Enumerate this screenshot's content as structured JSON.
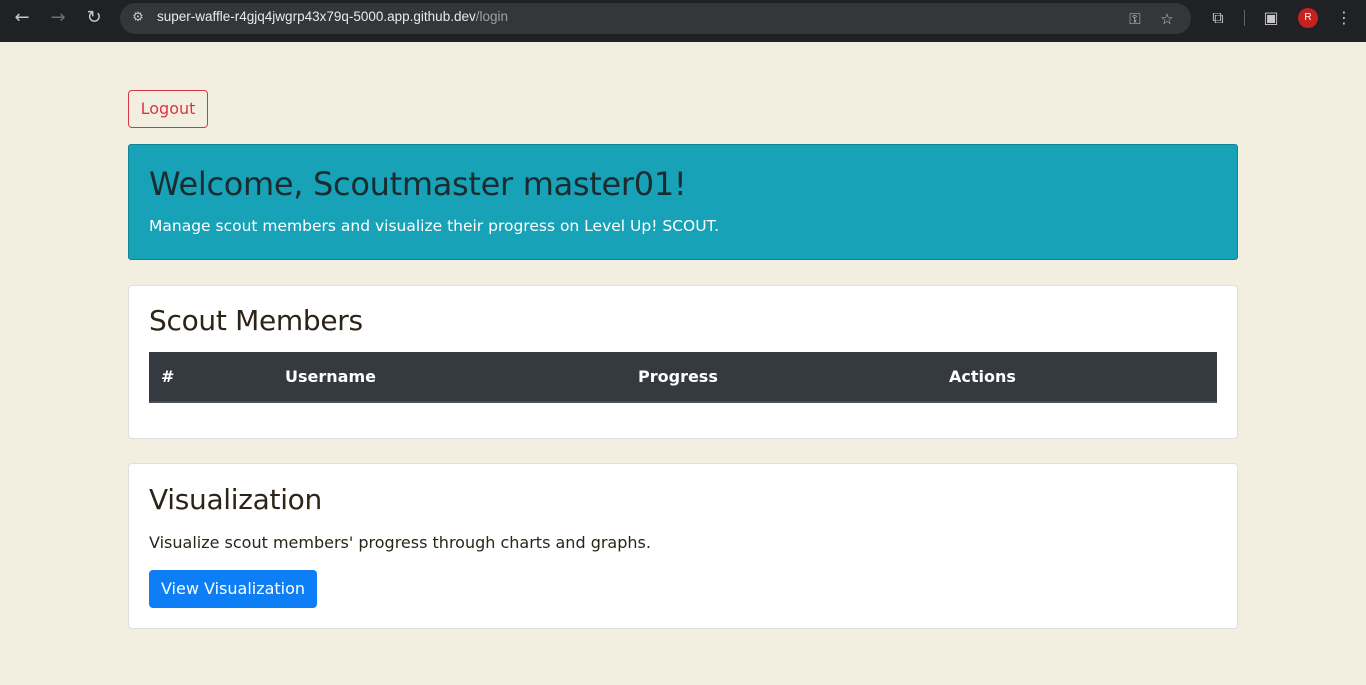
{
  "browser": {
    "back_icon": "←",
    "forward_icon": "→",
    "reload_icon": "↻",
    "site_info_icon": "⚙",
    "url_host": "super-waffle-r4gjq4jwgrp43x79q-5000.app.github.dev",
    "url_path": "/login",
    "key_icon": "⚿",
    "star_icon": "☆",
    "extensions_icon": "⧉",
    "sidepanel_icon": "▣",
    "profile_initial": "R",
    "menu_icon": "⋮"
  },
  "header": {
    "logout_label": "Logout"
  },
  "jumbotron": {
    "title": "Welcome, Scoutmaster master01!",
    "subtitle": "Manage scout members and visualize their progress on Level Up! SCOUT."
  },
  "members": {
    "title": "Scout Members",
    "columns": [
      "#",
      "Username",
      "Progress",
      "Actions"
    ],
    "rows": []
  },
  "visualization": {
    "title": "Visualization",
    "description": "Visualize scout members' progress through charts and graphs.",
    "button_label": "View Visualization"
  },
  "colors": {
    "page_bg": "#f3efe0",
    "jumbotron_bg": "#17a2b8",
    "logout": "#dc3545",
    "primary": "#0d7ef5",
    "table_head": "#343a40"
  }
}
